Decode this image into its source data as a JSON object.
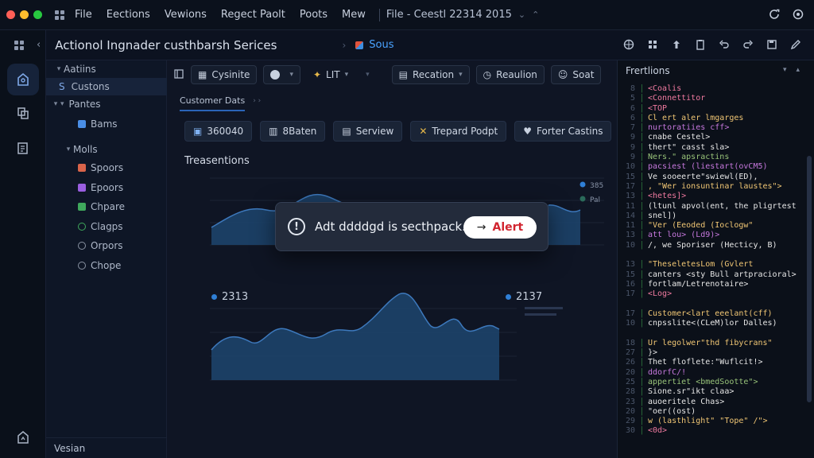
{
  "window": {
    "traffic_lights": [
      "#ff5f57",
      "#febc2e",
      "#28c840"
    ],
    "menu": [
      "File",
      "Eections",
      "Vewions",
      "Regect Paolt",
      "Poots",
      "Mew"
    ],
    "title": "File - Ceestl 22314 2015"
  },
  "header": {
    "project_title": "Actionol Ingnader custhbarsh Serices",
    "tab_name": "Sous"
  },
  "sidebar": {
    "items": [
      {
        "label": "Aatiins",
        "caret": "▾"
      },
      {
        "label": "Custons",
        "prefix": "S",
        "selected": true
      },
      {
        "label": "Pantes",
        "caret": "▾"
      },
      {
        "label": "Bams",
        "icon_color": "#4a8ee6"
      },
      {
        "label": "Molls",
        "caret": "▾"
      },
      {
        "label": "Spoors",
        "icon_color": "#d9644a"
      },
      {
        "label": "Epoors",
        "icon_color": "#9a5ee0"
      },
      {
        "label": "Chpare",
        "icon_color": "#3fa85c"
      },
      {
        "label": "Clagps",
        "icon_color": "#3fa85c"
      },
      {
        "label": "Orpors",
        "icon_color": "#8a93a3"
      },
      {
        "label": "Chope",
        "icon_color": "#8a93a3"
      }
    ],
    "footer": "Vesian"
  },
  "toolbar": {
    "buttons": [
      {
        "label": "Cysinite"
      },
      {
        "label": ""
      },
      {
        "label": "LIT"
      },
      {
        "label": "Recation"
      },
      {
        "label": "Reaulion"
      },
      {
        "label": "Soat"
      }
    ]
  },
  "tabs": {
    "active": "Customer Dats"
  },
  "actions": [
    {
      "label": "360040",
      "icon": "card-icon"
    },
    {
      "label": "8Baten",
      "icon": "hash-icon"
    },
    {
      "label": "Serview",
      "icon": "doc-icon"
    },
    {
      "label": "Trepard Podpt",
      "icon": "x-icon"
    },
    {
      "label": "Forter Castins",
      "icon": "heart-icon"
    }
  ],
  "section": {
    "title": "Treasentions"
  },
  "charts": {
    "top_legend": [
      "385",
      "Pal"
    ],
    "bottom_legend_left": "2313",
    "bottom_legend_right": "2137",
    "colors": {
      "area": "#1f4a77",
      "line": "#3d79bd",
      "legend_blue": "#2f7fd6"
    }
  },
  "toast": {
    "message": "Adt ddddgd is secthpack..",
    "button_label": "Alert",
    "button_color": "#d1242f"
  },
  "code_panel": {
    "title": "Frertlions",
    "lines": [
      {
        "n": "8",
        "t": "<Coalis",
        "c": "#f07aa0"
      },
      {
        "n": "5",
        "t": "<Connettitor",
        "c": "#f07aa0"
      },
      {
        "n": "6",
        "t": "<TOP",
        "c": "#f07aa0"
      },
      {
        "n": "6",
        "t": "Cl ert aler lmgarges",
        "c": "#f0c674"
      },
      {
        "n": "7",
        "t": "nurtoratiies cff>",
        "c": "#c678dd"
      },
      {
        "n": "9",
        "t": "cnabe Cestel>",
        "c": "#e6e6e6"
      },
      {
        "n": "9",
        "t": "  thert\" casst sla>",
        "c": "#e6e6e6"
      },
      {
        "n": "9",
        "t": "   Ners.\"  apsractins",
        "c": "#98c379"
      },
      {
        "n": "10",
        "t": "   pacsiest (liestart(ovCM5)",
        "c": "#c678dd"
      },
      {
        "n": "15",
        "t": "    Ve sooeerte\"swiewl(ED),",
        "c": "#e6e6e6"
      },
      {
        "n": "17",
        "t": ", \"Wer ionsuntinar laustes\">",
        "c": "#f0c674"
      },
      {
        "n": "13",
        "t": "<hetes]>",
        "c": "#f07aa0"
      },
      {
        "n": "11",
        "t": "(ltunl apvol(ent, the pligrtest",
        "c": "#e6e6e6"
      },
      {
        "n": "14",
        "t": "snel])",
        "c": "#e6e6e6"
      },
      {
        "n": "11",
        "t": "\"Ver (Eeoded (Ioclogw\"",
        "c": "#f0c674"
      },
      {
        "n": "13",
        "t": "   att lou> (Ld9)>",
        "c": "#c678dd"
      },
      {
        "n": "10",
        "t": "/, we Sporiser (Hecticy, B)",
        "c": "#e6e6e6"
      },
      {
        "n": "",
        "t": "",
        "c": "#e6e6e6"
      },
      {
        "n": "13",
        "t": "\"TheseletesLom (Gvlert",
        "c": "#f0c674"
      },
      {
        "n": "15",
        "t": "canters <sty Bull artpracioral>",
        "c": "#e6e6e6"
      },
      {
        "n": "16",
        "t": "fortlam/Letrenotaire>",
        "c": "#e6e6e6"
      },
      {
        "n": "17",
        "t": "<Log>",
        "c": "#f07aa0"
      },
      {
        "n": "",
        "t": "",
        "c": "#e6e6e6"
      },
      {
        "n": "17",
        "t": "Customer<lart eeelant(cff)",
        "c": "#f0c674"
      },
      {
        "n": "10",
        "t": "cnpsslite<(CLeM)lor Dalles)",
        "c": "#e6e6e6"
      },
      {
        "n": "",
        "t": "",
        "c": "#e6e6e6"
      },
      {
        "n": "18",
        "t": "   Ur legolwer\"thd fibycrans\"",
        "c": "#f0c674"
      },
      {
        "n": "27",
        "t": " }>",
        "c": "#e6e6e6"
      },
      {
        "n": "26",
        "t": "Thet floflete:\"Wuflcit!>",
        "c": "#e6e6e6"
      },
      {
        "n": "20",
        "t": "ddorfC/!",
        "c": "#c678dd"
      },
      {
        "n": "25",
        "t": "appertiet <bmedSootte\">",
        "c": "#98c379"
      },
      {
        "n": "28",
        "t": "Sione.sr\"ikt claa>",
        "c": "#e6e6e6"
      },
      {
        "n": "23",
        "t": "auoeritele Chas>",
        "c": "#e6e6e6"
      },
      {
        "n": "20",
        "t": "\"oer((ost)",
        "c": "#e6e6e6"
      },
      {
        "n": "29",
        "t": "w  (lasthlight\" \"Tope\" /\">",
        "c": "#f0c674"
      },
      {
        "n": "30",
        "t": "<0d>",
        "c": "#f07aa0"
      }
    ]
  }
}
